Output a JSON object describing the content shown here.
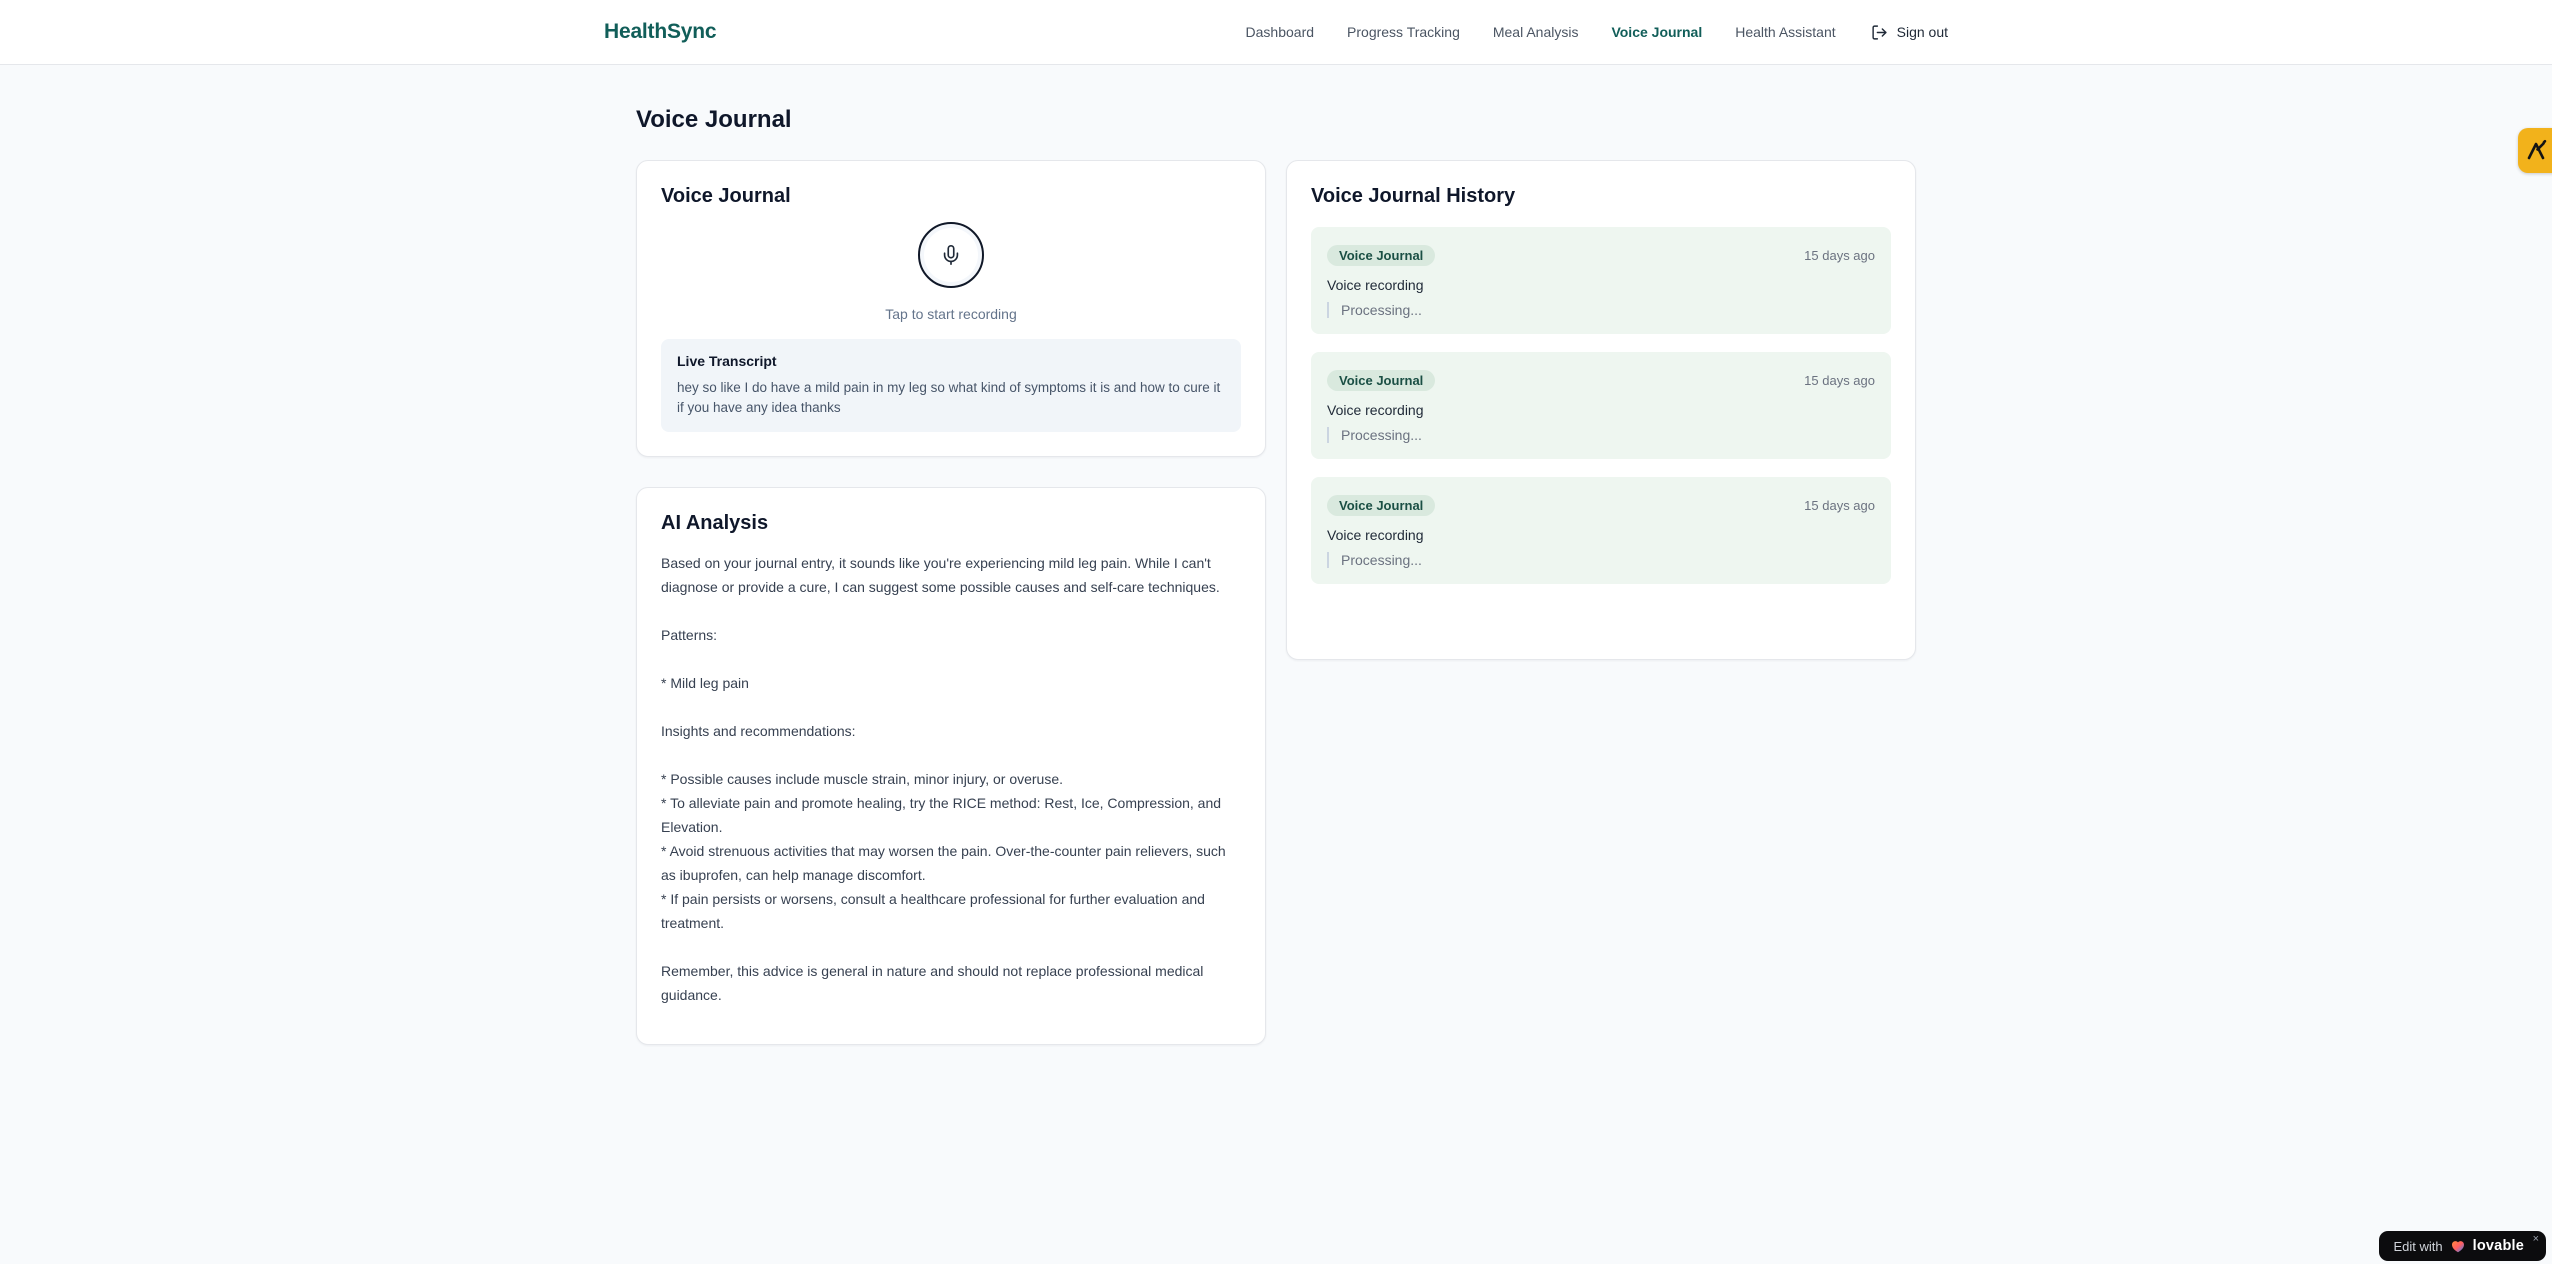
{
  "brand": {
    "name": "HealthSync"
  },
  "nav": {
    "items": [
      {
        "label": "Dashboard",
        "active": false
      },
      {
        "label": "Progress Tracking",
        "active": false
      },
      {
        "label": "Meal Analysis",
        "active": false
      },
      {
        "label": "Voice Journal",
        "active": true
      },
      {
        "label": "Health Assistant",
        "active": false
      }
    ],
    "sign_out_label": "Sign out"
  },
  "page": {
    "title": "Voice Journal"
  },
  "recorder": {
    "card_title": "Voice Journal",
    "tap_hint": "Tap to start recording",
    "transcript_title": "Live Transcript",
    "transcript_text": "hey so like I do have a mild pain in my leg so what kind of symptoms it is and how to cure it if you have any idea thanks"
  },
  "analysis": {
    "card_title": "AI Analysis",
    "body": "Based on your journal entry, it sounds like you're experiencing mild leg pain. While I can't diagnose or provide a cure, I can suggest some possible causes and self-care techniques.\n\nPatterns:\n\n* Mild leg pain\n\nInsights and recommendations:\n\n* Possible causes include muscle strain, minor injury, or overuse.\n* To alleviate pain and promote healing, try the RICE method: Rest, Ice, Compression, and Elevation.\n* Avoid strenuous activities that may worsen the pain. Over-the-counter pain relievers, such as ibuprofen, can help manage discomfort.\n* If pain persists or worsens, consult a healthcare professional for further evaluation and treatment.\n\nRemember, this advice is general in nature and should not replace professional medical guidance."
  },
  "history": {
    "card_title": "Voice Journal History",
    "entries": [
      {
        "badge": "Voice Journal",
        "time": "15 days ago",
        "title": "Voice recording",
        "status": "Processing..."
      },
      {
        "badge": "Voice Journal",
        "time": "15 days ago",
        "title": "Voice recording",
        "status": "Processing..."
      },
      {
        "badge": "Voice Journal",
        "time": "15 days ago",
        "title": "Voice recording",
        "status": "Processing..."
      }
    ]
  },
  "overlays": {
    "edit_badge": {
      "prefix": "Edit with",
      "brand": "lovable",
      "close": "×"
    }
  },
  "colors": {
    "brand_teal": "#115e59",
    "page_bg": "#f8fafc",
    "entry_bg": "#eef6f0",
    "badge_bg": "#d9e9de",
    "badge_text": "#1a4f44",
    "side_badge_amber": "#f2b21b",
    "edit_badge_bg": "#0c0c0e"
  }
}
